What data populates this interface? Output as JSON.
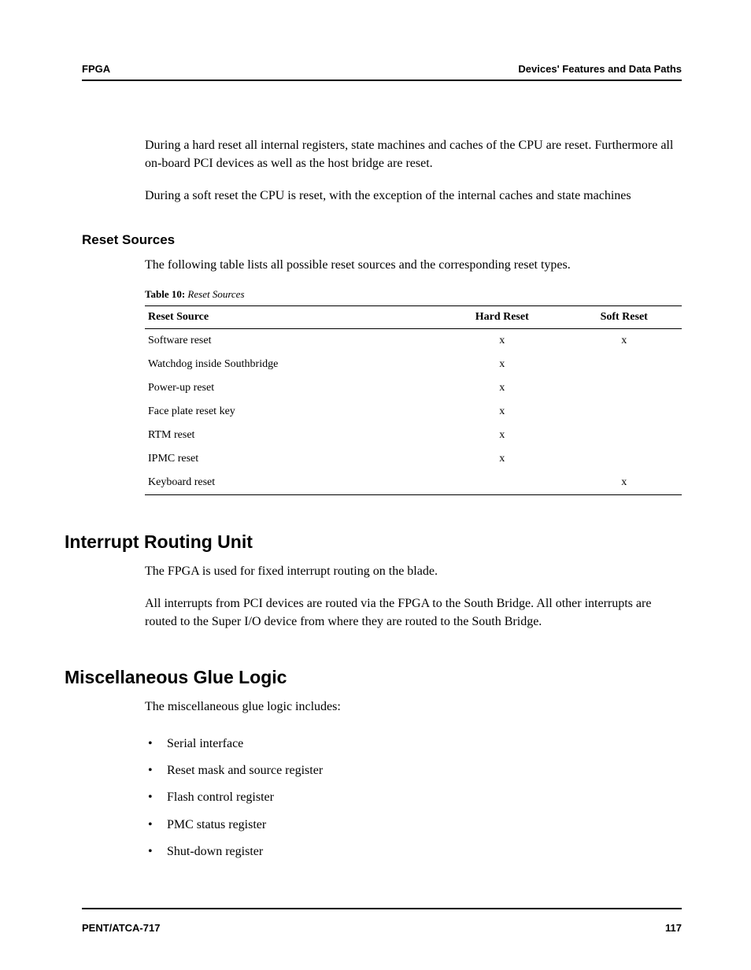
{
  "header": {
    "left": "FPGA",
    "right": "Devices' Features and Data Paths"
  },
  "intro": {
    "p1": "During a hard reset all internal registers, state machines and caches of the CPU are reset. Furthermore all on-board PCI devices as well as the host bridge are reset.",
    "p2": "During a soft reset the CPU is reset, with the exception of the internal caches and state machines"
  },
  "reset_sources": {
    "heading": "Reset Sources",
    "lead": "The following table lists all possible reset sources and the corresponding reset types.",
    "caption_label": "Table 10:",
    "caption_title": "Reset Sources",
    "columns": [
      "Reset Source",
      "Hard Reset",
      "Soft Reset"
    ],
    "rows": [
      {
        "source": "Software reset",
        "hard": "x",
        "soft": "x"
      },
      {
        "source": "Watchdog inside Southbridge",
        "hard": "x",
        "soft": ""
      },
      {
        "source": "Power-up reset",
        "hard": "x",
        "soft": ""
      },
      {
        "source": "Face plate reset key",
        "hard": "x",
        "soft": ""
      },
      {
        "source": "RTM reset",
        "hard": "x",
        "soft": ""
      },
      {
        "source": "IPMC reset",
        "hard": "x",
        "soft": ""
      },
      {
        "source": "Keyboard reset",
        "hard": "",
        "soft": "x"
      }
    ]
  },
  "interrupt": {
    "heading": "Interrupt Routing Unit",
    "p1": "The FPGA is used for fixed interrupt routing on the blade.",
    "p2": "All interrupts from PCI devices are routed via the FPGA to the South Bridge. All other interrupts are routed to the Super I/O device from where they are routed to the South Bridge."
  },
  "glue": {
    "heading": "Miscellaneous Glue Logic",
    "lead": "The miscellaneous glue logic includes:",
    "items": [
      "Serial interface",
      "Reset mask and source register",
      "Flash control register",
      "PMC status register",
      "Shut-down register"
    ]
  },
  "footer": {
    "left": "PENT/ATCA-717",
    "right": "117"
  }
}
